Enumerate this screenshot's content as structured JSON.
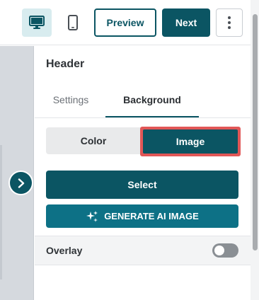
{
  "toolbar": {
    "device_desktop_icon": "desktop-icon",
    "device_mobile_icon": "mobile-icon",
    "preview_label": "Preview",
    "next_label": "Next",
    "more_icon": "more-vertical-icon"
  },
  "panel": {
    "title": "Header",
    "tabs": [
      {
        "label": "Settings",
        "active": false
      },
      {
        "label": "Background",
        "active": true
      }
    ],
    "segmented": {
      "options": [
        "Color",
        "Image"
      ],
      "selected": "Image"
    },
    "select_button": "Select",
    "ai_button": "GENERATE AI IMAGE",
    "overlay": {
      "label": "Overlay",
      "enabled": false
    }
  },
  "colors": {
    "primary": "#0b5563",
    "ai_button": "#0d7186",
    "highlight_border": "#e15757",
    "desktop_selected_bg": "#d8ecef"
  }
}
